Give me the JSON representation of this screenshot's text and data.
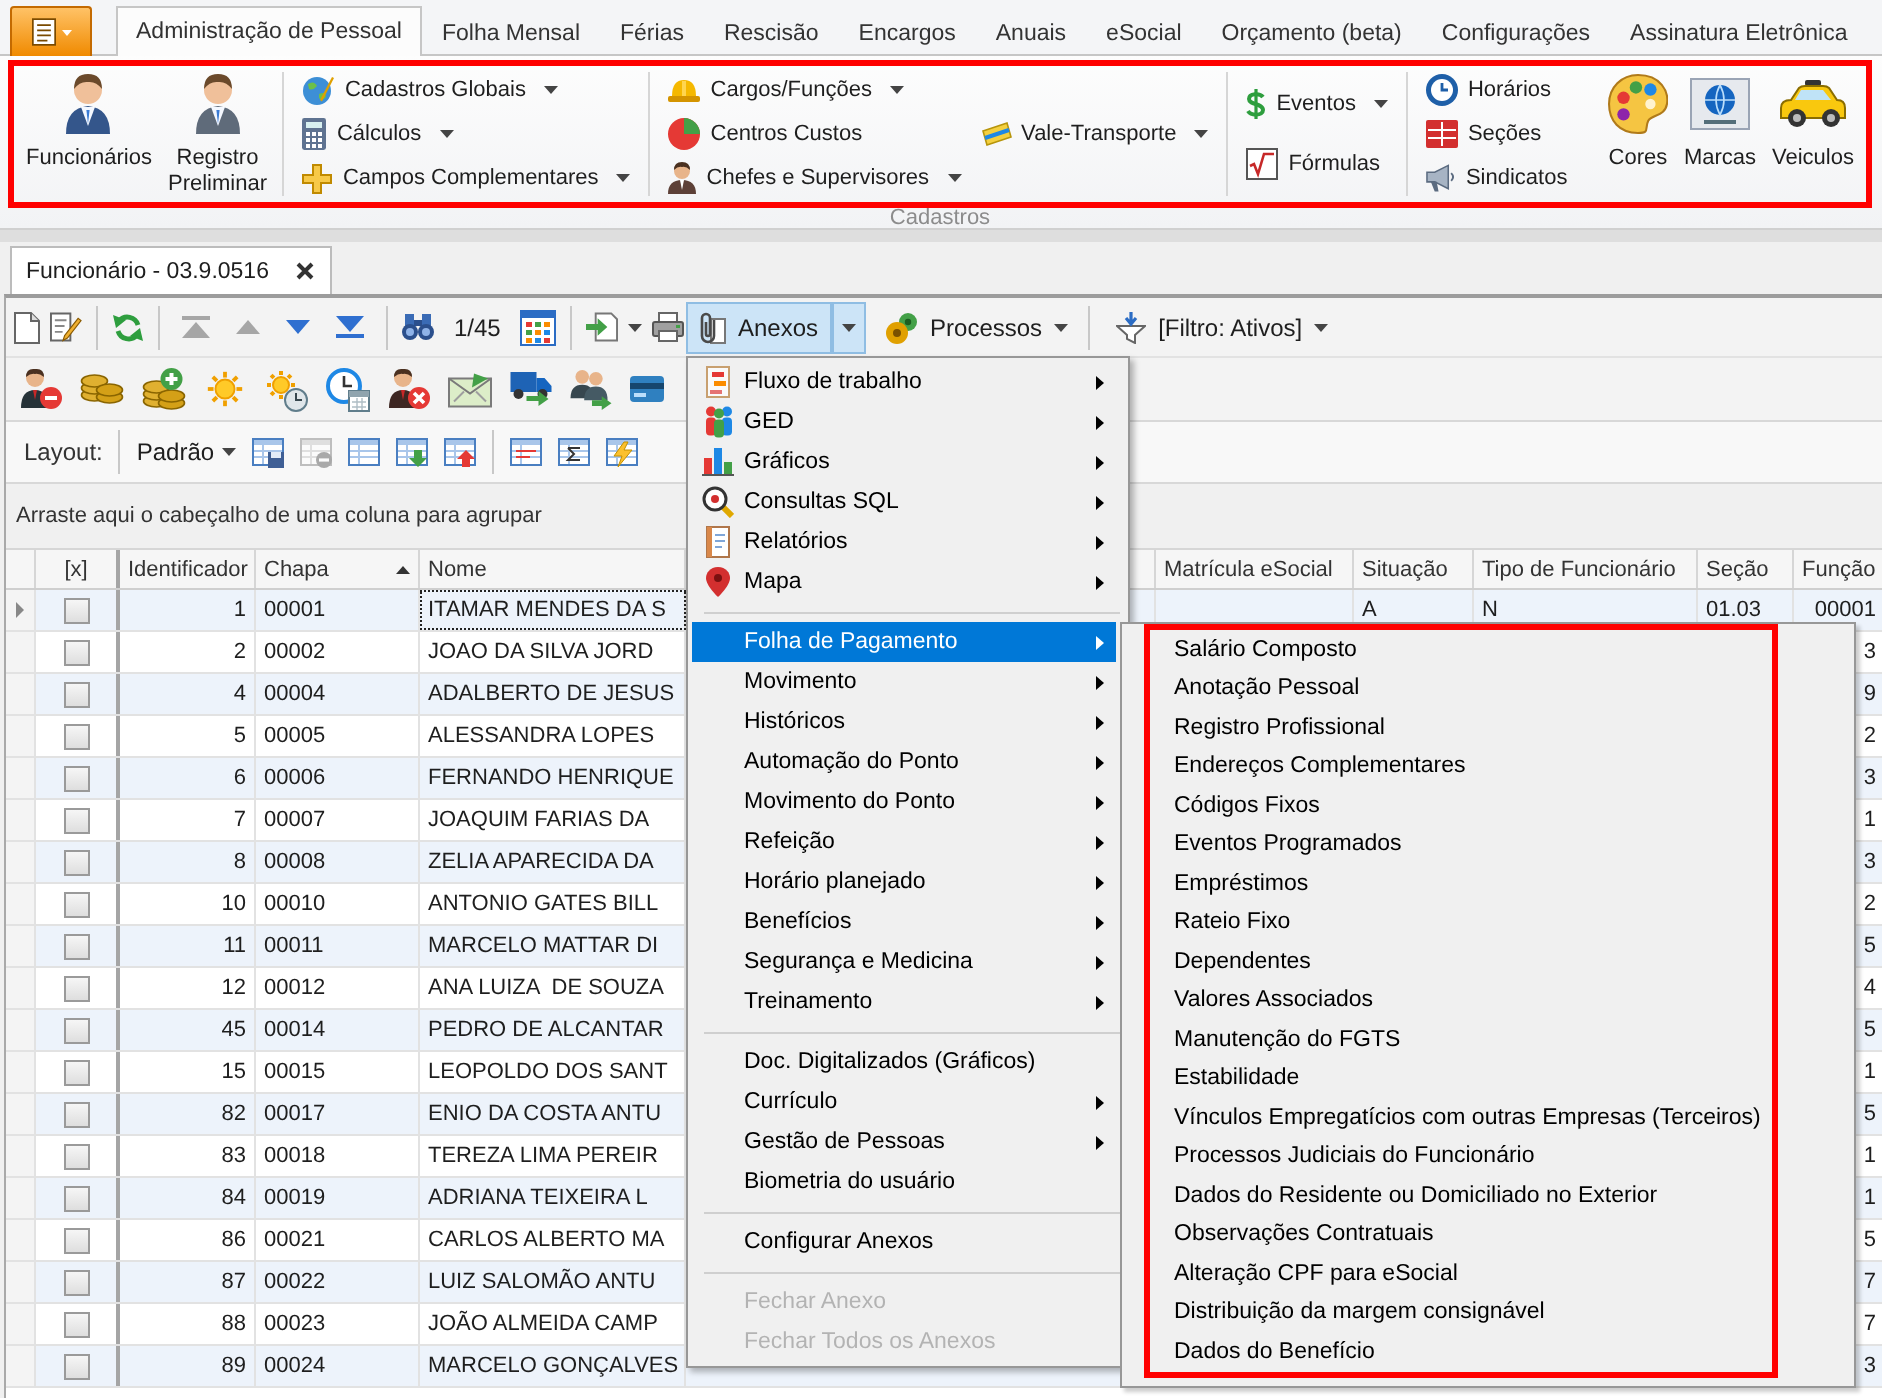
{
  "ribbon_tabs": [
    {
      "label": "Administração de Pessoal",
      "selected": true
    },
    {
      "label": "Folha Mensal",
      "selected": false
    },
    {
      "label": "Férias",
      "selected": false
    },
    {
      "label": "Rescisão",
      "selected": false
    },
    {
      "label": "Encargos",
      "selected": false
    },
    {
      "label": "Anuais",
      "selected": false
    },
    {
      "label": "eSocial",
      "selected": false
    },
    {
      "label": "Orçamento (beta)",
      "selected": false
    },
    {
      "label": "Configurações",
      "selected": false
    },
    {
      "label": "Assinatura Eletrônica",
      "selected": false
    }
  ],
  "ribbon": {
    "highlighted": true,
    "group_label": "Cadastros",
    "sections": [
      {
        "blocks": [
          {
            "kind": "large",
            "items": [
              {
                "label": "Funcionários",
                "has_dropdown": false
              }
            ]
          },
          {
            "kind": "large",
            "items": [
              {
                "label": "Registro Preliminar",
                "has_dropdown": false
              }
            ]
          }
        ]
      },
      {
        "blocks": [
          {
            "kind": "stack",
            "items": [
              {
                "label": "Cadastros Globais",
                "has_dropdown": true
              },
              {
                "label": "Cálculos",
                "has_dropdown": true
              },
              {
                "label": "Campos Complementares",
                "has_dropdown": true
              }
            ]
          }
        ]
      },
      {
        "blocks": [
          {
            "kind": "stack",
            "items": [
              {
                "label": "Cargos/Funções",
                "has_dropdown": true
              },
              {
                "label": "Centros Custos",
                "has_dropdown": false
              },
              {
                "label": "Chefes e Supervisores",
                "has_dropdown": true
              }
            ]
          },
          {
            "kind": "stack",
            "items": [
              {
                "label": "Vale-Transporte",
                "has_dropdown": true
              }
            ]
          }
        ]
      },
      {
        "blocks": [
          {
            "kind": "stack",
            "items": [
              {
                "label": "Eventos",
                "has_dropdown": true
              },
              {
                "label": "Fórmulas",
                "has_dropdown": false
              }
            ]
          }
        ]
      },
      {
        "blocks": [
          {
            "kind": "stack",
            "items": [
              {
                "label": "Horários",
                "has_dropdown": false
              },
              {
                "label": "Seções",
                "has_dropdown": false
              },
              {
                "label": "Sindicatos",
                "has_dropdown": false
              }
            ]
          },
          {
            "kind": "large",
            "items": [
              {
                "label": "Cores",
                "has_dropdown": false
              }
            ]
          },
          {
            "kind": "large",
            "items": [
              {
                "label": "Marcas",
                "has_dropdown": false
              }
            ]
          },
          {
            "kind": "large",
            "items": [
              {
                "label": "Veiculos",
                "has_dropdown": false
              }
            ]
          }
        ]
      }
    ]
  },
  "document_tabs": [
    {
      "title": "Funcionário - 03.9.0516",
      "selected": true
    }
  ],
  "toolbar": {
    "navigation": [
      {
        "disabled": true
      },
      {
        "disabled": true
      },
      {
        "disabled": false
      },
      {
        "disabled": false
      }
    ],
    "record_position": "1/45",
    "buttons": [
      {
        "kind": "split",
        "label": "Anexos",
        "expanded": true
      },
      {
        "kind": "dropdown",
        "label": "Processos",
        "expanded": false
      },
      {
        "kind": "dropdown",
        "label": "[Filtro: Ativos]",
        "expanded": false
      }
    ]
  },
  "layout_bar": {
    "label": "Layout:",
    "preset": "Padrão",
    "tools": [
      {
        "disabled": false
      },
      {
        "disabled": true
      },
      {
        "disabled": false
      },
      {
        "disabled": false
      },
      {
        "disabled": false
      },
      {
        "disabled": false
      },
      {
        "disabled": false
      },
      {
        "disabled": false
      }
    ]
  },
  "group_panel": {
    "hint": "Arraste aqui o cabeçalho de uma coluna para agrupar"
  },
  "table": {
    "columns": [
      {
        "label": "[x]",
        "sorted": false
      },
      {
        "label": "Identificador",
        "sorted": false
      },
      {
        "label": "Chapa",
        "sorted": true
      },
      {
        "label": "Nome",
        "sorted": false
      },
      {
        "label": "Matrícula eSocial",
        "sorted": false
      },
      {
        "label": "Situação",
        "sorted": false
      },
      {
        "label": "Tipo de Funcionário",
        "sorted": false
      },
      {
        "label": "Seção",
        "sorted": false
      },
      {
        "label": "Função",
        "sorted": false
      }
    ],
    "rows": [
      {
        "selected": true,
        "checked": false,
        "identificador": "1",
        "chapa": "00001",
        "nome": "ITAMAR MENDES DA S",
        "situacao": "A",
        "tipo_de_funcionario": "N",
        "secao": "01.03",
        "funcao": "00001"
      },
      {
        "selected": false,
        "checked": false,
        "identificador": "2",
        "chapa": "00002",
        "nome": "JOAO DA SILVA JORD",
        "funcao": "3"
      },
      {
        "selected": false,
        "checked": false,
        "identificador": "4",
        "chapa": "00004",
        "nome": "ADALBERTO DE JESUS",
        "funcao": "9"
      },
      {
        "selected": false,
        "checked": false,
        "identificador": "5",
        "chapa": "00005",
        "nome": "ALESSANDRA LOPES",
        "funcao": "2"
      },
      {
        "selected": false,
        "checked": false,
        "identificador": "6",
        "chapa": "00006",
        "nome": "FERNANDO HENRIQUE",
        "funcao": "3"
      },
      {
        "selected": false,
        "checked": false,
        "identificador": "7",
        "chapa": "00007",
        "nome": "JOAQUIM FARIAS DA",
        "funcao": "1"
      },
      {
        "selected": false,
        "checked": false,
        "identificador": "8",
        "chapa": "00008",
        "nome": "ZELIA APARECIDA DA",
        "funcao": "3"
      },
      {
        "selected": false,
        "checked": false,
        "identificador": "10",
        "chapa": "00010",
        "nome": "ANTONIO GATES BILL",
        "funcao": "2"
      },
      {
        "selected": false,
        "checked": false,
        "identificador": "11",
        "chapa": "00011",
        "nome": "MARCELO MATTAR DI",
        "funcao": "5"
      },
      {
        "selected": false,
        "checked": false,
        "identificador": "12",
        "chapa": "00012",
        "nome": "ANA LUIZA  DE SOUZA",
        "funcao": "4"
      },
      {
        "selected": false,
        "checked": false,
        "identificador": "45",
        "chapa": "00014",
        "nome": "PEDRO DE ALCANTAR",
        "funcao": "5"
      },
      {
        "selected": false,
        "checked": false,
        "identificador": "15",
        "chapa": "00015",
        "nome": "LEOPOLDO DOS SANT",
        "funcao": "1"
      },
      {
        "selected": false,
        "checked": false,
        "identificador": "82",
        "chapa": "00017",
        "nome": "ENIO DA COSTA ANTU",
        "funcao": "5"
      },
      {
        "selected": false,
        "checked": false,
        "identificador": "83",
        "chapa": "00018",
        "nome": "TEREZA LIMA PEREIR",
        "funcao": "1"
      },
      {
        "selected": false,
        "checked": false,
        "identificador": "84",
        "chapa": "00019",
        "nome": "ADRIANA TEIXEIRA L",
        "funcao": "1"
      },
      {
        "selected": false,
        "checked": false,
        "identificador": "86",
        "chapa": "00021",
        "nome": "CARLOS ALBERTO MA",
        "funcao": "5"
      },
      {
        "selected": false,
        "checked": false,
        "identificador": "87",
        "chapa": "00022",
        "nome": "LUIZ SALOMÃO ANTU",
        "funcao": "7"
      },
      {
        "selected": false,
        "checked": false,
        "identificador": "88",
        "chapa": "00023",
        "nome": "JOÃO ALMEIDA CAMP",
        "funcao": "7"
      },
      {
        "selected": false,
        "checked": false,
        "identificador": "89",
        "chapa": "00024",
        "nome": "MARCELO GONÇALVES",
        "funcao": "3"
      }
    ]
  },
  "attachments_menu": {
    "sections": [
      {
        "items": [
          {
            "label": "Fluxo de trabalho",
            "has_submenu": true,
            "selected": false,
            "disabled": false
          },
          {
            "label": "GED",
            "has_submenu": true,
            "selected": false,
            "disabled": false
          },
          {
            "label": "Gráficos",
            "has_submenu": true,
            "selected": false,
            "disabled": false
          },
          {
            "label": "Consultas SQL",
            "has_submenu": true,
            "selected": false,
            "disabled": false
          },
          {
            "label": "Relatórios",
            "has_submenu": true,
            "selected": false,
            "disabled": false
          },
          {
            "label": "Mapa",
            "has_submenu": true,
            "selected": false,
            "disabled": false
          }
        ]
      },
      {
        "items": [
          {
            "label": "Folha de Pagamento",
            "has_submenu": true,
            "selected": true,
            "disabled": false
          },
          {
            "label": "Movimento",
            "has_submenu": true,
            "selected": false,
            "disabled": false
          },
          {
            "label": "Históricos",
            "has_submenu": true,
            "selected": false,
            "disabled": false
          },
          {
            "label": "Automação do Ponto",
            "has_submenu": true,
            "selected": false,
            "disabled": false
          },
          {
            "label": "Movimento do Ponto",
            "has_submenu": true,
            "selected": false,
            "disabled": false
          },
          {
            "label": "Refeição",
            "has_submenu": true,
            "selected": false,
            "disabled": false
          },
          {
            "label": "Horário planejado",
            "has_submenu": true,
            "selected": false,
            "disabled": false
          },
          {
            "label": "Benefícios",
            "has_submenu": true,
            "selected": false,
            "disabled": false
          },
          {
            "label": "Segurança e Medicina",
            "has_submenu": true,
            "selected": false,
            "disabled": false
          },
          {
            "label": "Treinamento",
            "has_submenu": true,
            "selected": false,
            "disabled": false
          }
        ]
      },
      {
        "items": [
          {
            "label": "Doc. Digitalizados (Gráficos)",
            "has_submenu": false,
            "selected": false,
            "disabled": false
          },
          {
            "label": "Currículo",
            "has_submenu": true,
            "selected": false,
            "disabled": false
          },
          {
            "label": "Gestão de Pessoas",
            "has_submenu": true,
            "selected": false,
            "disabled": false
          },
          {
            "label": "Biometria do usuário",
            "has_submenu": false,
            "selected": false,
            "disabled": false
          }
        ]
      },
      {
        "items": [
          {
            "label": "Configurar Anexos",
            "has_submenu": false,
            "selected": false,
            "disabled": false
          }
        ]
      },
      {
        "items": [
          {
            "label": "Fechar Anexo",
            "has_submenu": false,
            "selected": false,
            "disabled": true
          },
          {
            "label": "Fechar Todos os Anexos",
            "has_submenu": false,
            "selected": false,
            "disabled": true
          }
        ]
      }
    ]
  },
  "submenu": {
    "highlighted": true,
    "items": [
      {
        "label": "Salário Composto"
      },
      {
        "label": "Anotação Pessoal"
      },
      {
        "label": "Registro Profissional"
      },
      {
        "label": "Endereços Complementares"
      },
      {
        "label": "Códigos Fixos"
      },
      {
        "label": "Eventos Programados"
      },
      {
        "label": "Empréstimos"
      },
      {
        "label": "Rateio Fixo"
      },
      {
        "label": "Dependentes"
      },
      {
        "label": "Valores Associados"
      },
      {
        "label": "Manutenção do FGTS"
      },
      {
        "label": "Estabilidade"
      },
      {
        "label": "Vínculos Empregatícios com outras Empresas (Terceiros)"
      },
      {
        "label": "Processos Judiciais do Funcionário"
      },
      {
        "label": "Dados do Residente ou Domiciliado no Exterior"
      },
      {
        "label": "Observações Contratuais"
      },
      {
        "label": "Alteração CPF para eSocial"
      },
      {
        "label": "Distribuição da margem consignável"
      },
      {
        "label": "Dados do Benefício"
      }
    ]
  }
}
